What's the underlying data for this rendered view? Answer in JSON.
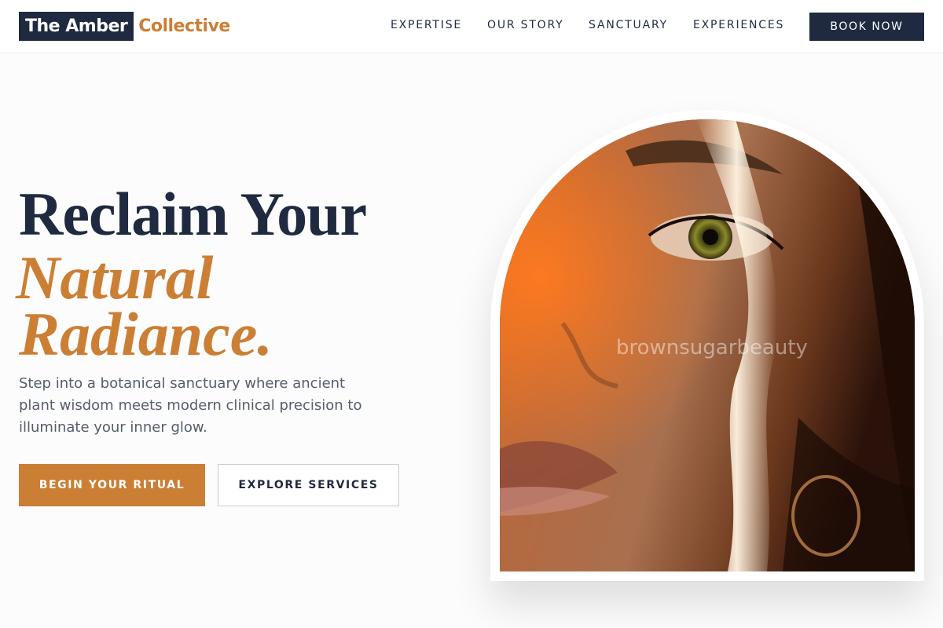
{
  "brand": {
    "name_box": "The Amber",
    "name_accent": "Collective"
  },
  "nav": {
    "items": [
      {
        "label": "EXPERTISE"
      },
      {
        "label": "OUR STORY"
      },
      {
        "label": "SANCTUARY"
      },
      {
        "label": "EXPERIENCES"
      }
    ],
    "cta_label": "BOOK NOW"
  },
  "hero": {
    "headline_line1": "Reclaim Your",
    "headline_line2": "Natural",
    "headline_line3": "Radiance.",
    "description": "Step into a botanical sanctuary where ancient plant wisdom meets modern clinical precision to illuminate your inner glow.",
    "primary_button": "BEGIN YOUR RITUAL",
    "secondary_button": "EXPLORE SERVICES",
    "image_watermark": "brownsugarbeauty"
  },
  "colors": {
    "navy": "#1f2a40",
    "amber": "#cb7f35",
    "background": "#fcfcfc",
    "body_text": "#555d6d"
  }
}
